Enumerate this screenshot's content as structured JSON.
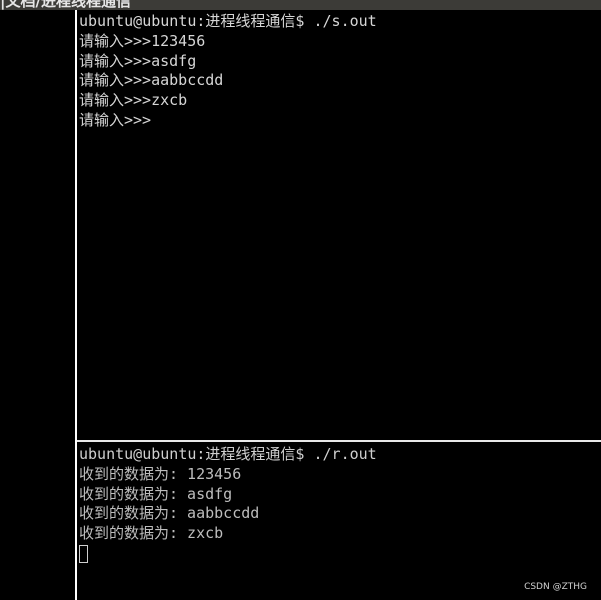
{
  "window": {
    "title": "|文档/进程线程通信"
  },
  "top_terminal": {
    "lines": [
      "ubuntu@ubuntu:进程线程通信$ ./s.out",
      "请输入>>>123456",
      "请输入>>>asdfg",
      "请输入>>>aabbccdd",
      "请输入>>>zxcb",
      "请输入>>>"
    ]
  },
  "bottom_terminal": {
    "lines": [
      "ubuntu@ubuntu:进程线程通信$ ./r.out",
      "收到的数据为: 123456",
      "收到的数据为: asdfg",
      "收到的数据为: aabbccdd",
      "收到的数据为: zxcb"
    ]
  },
  "watermark": "CSDN @ZTHG"
}
